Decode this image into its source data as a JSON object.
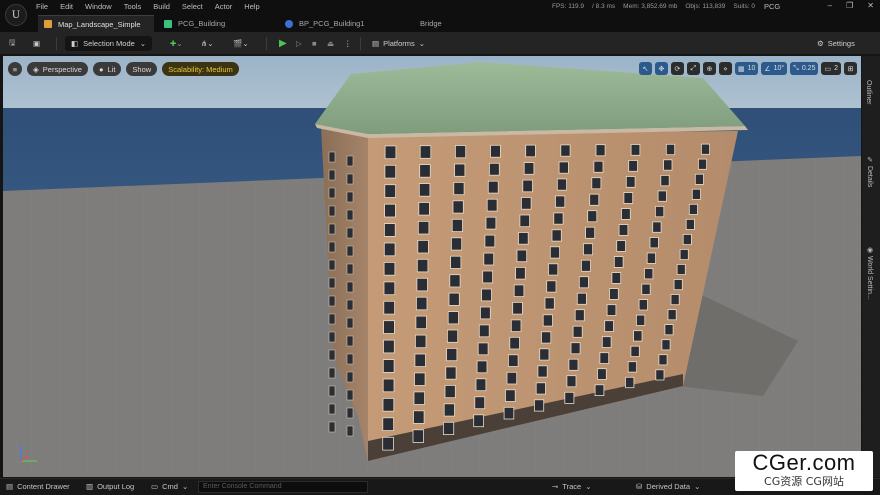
{
  "app": {
    "menu": [
      "File",
      "Edit",
      "Window",
      "Tools",
      "Build",
      "Select",
      "Actor",
      "Help"
    ],
    "stats": [
      "FPS: 119.9",
      "/ 8.3 ms",
      "Mem: 3,852.69 mb",
      "Objs: 113,839",
      "Suits: 0"
    ],
    "project": "PCG",
    "logo": "U"
  },
  "tabs": [
    {
      "label": "Map_Landscape_Simple",
      "icon": "level-icon",
      "color": "#e39b3c"
    },
    {
      "label": "PCG_Building",
      "icon": "pcg-graph-icon",
      "color": "#3fbf7f"
    },
    {
      "label": "BP_PCG_Building1",
      "icon": "blueprint-icon",
      "color": "#3d6fd6"
    },
    {
      "label": "Bridge",
      "icon": "",
      "color": ""
    }
  ],
  "toolbar": {
    "selection_mode": "Selection Mode",
    "platforms": "Platforms",
    "settings": "Settings"
  },
  "viewport": {
    "perspective": "Perspective",
    "lit": "Lit",
    "show": "Show",
    "scalability": "Scalability: Medium",
    "grid_snap": "10",
    "rotation_snap": "10°",
    "scale_snap": "0.25",
    "camera_speed": "2",
    "colors": {
      "sky": "#a9bfd0",
      "sea": "#34567f",
      "ground": "#7f7d7b",
      "roof": "#8fae8d",
      "facade": "#b58d6c"
    }
  },
  "sidebar": {
    "outliner": "Outliner",
    "details": "Details",
    "world_settings": "World Settin..."
  },
  "bottom": {
    "content_drawer": "Content Drawer",
    "output_log": "Output Log",
    "cmd": "Cmd",
    "console_placeholder": "Enter Console Command",
    "trace": "Trace",
    "derived_data": "Derived Data"
  },
  "watermark": {
    "line1": "CGer.com",
    "line2": "CG资源 CG网站"
  }
}
